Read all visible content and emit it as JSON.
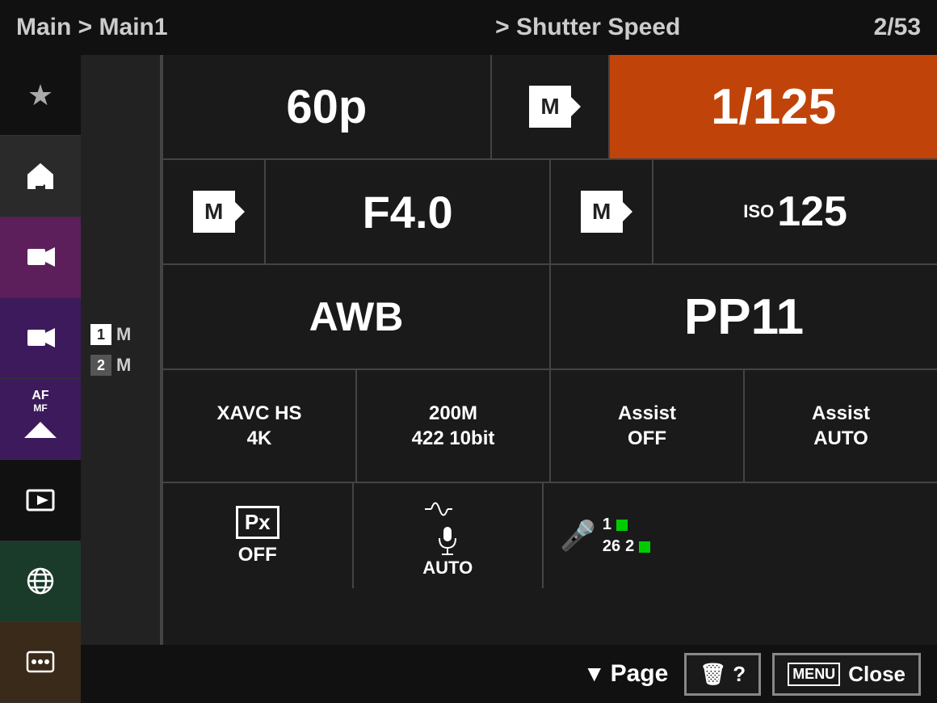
{
  "header": {
    "breadcrumb": "Main > Main1",
    "section": "> Shutter Speed",
    "page": "2/53"
  },
  "sidebar": {
    "items": [
      {
        "label": "★",
        "name": "star",
        "color": "default"
      },
      {
        "label": "home",
        "name": "home",
        "color": "active-home"
      },
      {
        "label": "video",
        "name": "video",
        "color": "color-purple"
      },
      {
        "label": "custom",
        "name": "custom",
        "color": "color-darkpurple"
      },
      {
        "label": "af-mf",
        "name": "af-mf",
        "color": "color-darkpurple"
      },
      {
        "label": "playback",
        "name": "playback",
        "color": "default"
      },
      {
        "label": "globe",
        "name": "globe",
        "color": "color-darkgreen"
      },
      {
        "label": "tools",
        "name": "tools",
        "color": "color-darkbrown"
      }
    ]
  },
  "memory_slots": [
    {
      "number": "1",
      "label": "M",
      "active": true
    },
    {
      "number": "2",
      "label": "M",
      "active": false
    }
  ],
  "row1": {
    "framerate": "60p",
    "m_icon": "M",
    "shutter_speed": "1/125"
  },
  "row2": {
    "m_icon1": "M",
    "aperture": "F4.0",
    "m_icon2": "M",
    "iso_label": "ISO",
    "iso_value": "125"
  },
  "row3": {
    "wb": "AWB",
    "picture_profile": "PP11"
  },
  "row4": {
    "codec1": "XAVC HS",
    "codec2": "4K",
    "bitrate1": "200M",
    "bitrate2": "422 10bit",
    "assist1_label": "Assist",
    "assist1_value": "OFF",
    "assist2_label": "Assist",
    "assist2_value": "AUTO"
  },
  "row5": {
    "px_label": "Px",
    "px_value": "OFF",
    "audio_label": "AUTO",
    "mic_level1_num": "1",
    "mic_level2_num": "2",
    "level1_value": "26"
  },
  "bottom": {
    "page_icon": "▼",
    "page_label": "Page",
    "trash_icon": "🗑",
    "help_icon": "?",
    "menu_label": "MENU",
    "close_label": "Close"
  }
}
